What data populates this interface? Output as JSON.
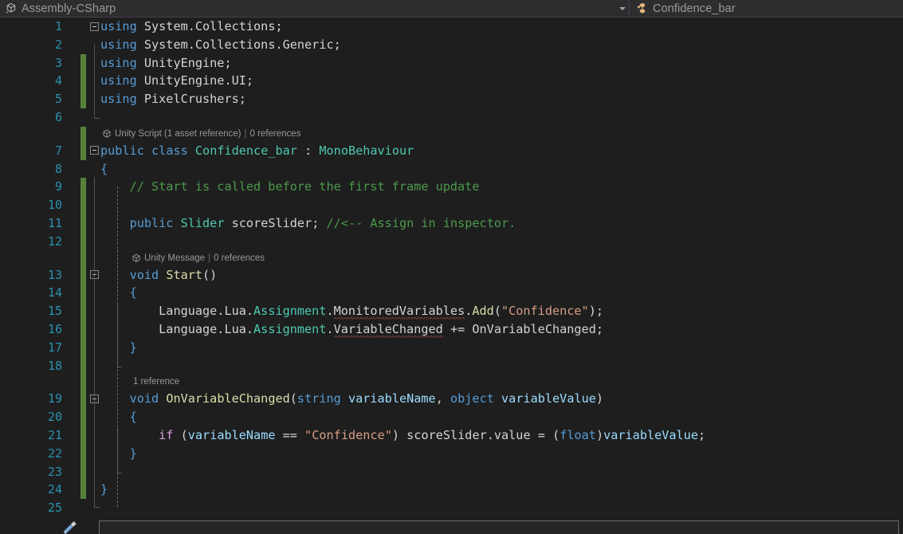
{
  "window": {
    "title": "Assembly-CSharp - Visual Studio code editor"
  },
  "navbar": {
    "project_selector": {
      "icon": "assembly-cube-icon",
      "label": "Assembly-CSharp",
      "dropdown_icon": "chevron-down-icon"
    },
    "member_selector": {
      "icon": "class-icon",
      "label": "Confidence_bar"
    }
  },
  "editor": {
    "language": "C#",
    "file_symbol": "Confidence_bar",
    "gutter_icon": "screwdriver-quick-actions-icon",
    "colors": {
      "background": "#1e1e1e",
      "navbar_background": "#2d2d30",
      "line_number": "#2b91af",
      "change_bar_green": "#57803a",
      "keyword_blue": "#569cd6",
      "type_teal": "#4ec9b0",
      "string_orange": "#d69d85",
      "comment_green": "#4c9a4c",
      "method_yellow": "#dcdcaa",
      "parameter_lightblue": "#9cdcfe",
      "control_purple": "#d8a0df",
      "error_squiggle_red": "#d95b5b",
      "codelens_gray": "#999999",
      "default_text": "#d4d4d4"
    },
    "codelens": [
      {
        "id": "class-lens",
        "icon": "unity-cube-icon",
        "primary": "Unity Script (1 asset reference)",
        "separator": "|",
        "secondary": "0 references"
      },
      {
        "id": "start-lens",
        "icon": "unity-cube-icon",
        "primary": "Unity Message",
        "separator": "|",
        "secondary": "0 references"
      },
      {
        "id": "onvar-lens",
        "icon": "",
        "primary": "1 reference",
        "separator": "",
        "secondary": ""
      }
    ],
    "lines": [
      {
        "n": "1",
        "text": "using System.Collections;"
      },
      {
        "n": "2",
        "text": "using System.Collections.Generic;"
      },
      {
        "n": "3",
        "text": "using UnityEngine;"
      },
      {
        "n": "4",
        "text": "using UnityEngine.UI;"
      },
      {
        "n": "5",
        "text": "using PixelCrushers;"
      },
      {
        "n": "6",
        "text": ""
      },
      {
        "n": "7",
        "text": "public class Confidence_bar : MonoBehaviour"
      },
      {
        "n": "8",
        "text": "{"
      },
      {
        "n": "9",
        "text": "    // Start is called before the first frame update"
      },
      {
        "n": "10",
        "text": ""
      },
      {
        "n": "11",
        "text": "    public Slider scoreSlider; //<-- Assign in inspector."
      },
      {
        "n": "12",
        "text": ""
      },
      {
        "n": "13",
        "text": "    void Start()"
      },
      {
        "n": "14",
        "text": "    {"
      },
      {
        "n": "15",
        "text": "        Language.Lua.Assignment.MonitoredVariables.Add(\"Confidence\");"
      },
      {
        "n": "16",
        "text": "        Language.Lua.Assignment.VariableChanged += OnVariableChanged;"
      },
      {
        "n": "17",
        "text": "    }"
      },
      {
        "n": "18",
        "text": ""
      },
      {
        "n": "19",
        "text": "    void OnVariableChanged(string variableName, object variableValue)"
      },
      {
        "n": "20",
        "text": "    {"
      },
      {
        "n": "21",
        "text": "        if (variableName == \"Confidence\") scoreSlider.value = (float)variableValue;"
      },
      {
        "n": "22",
        "text": "    }"
      },
      {
        "n": "23",
        "text": ""
      },
      {
        "n": "24",
        "text": "}"
      },
      {
        "n": "25",
        "text": ""
      }
    ],
    "errors": [
      {
        "line": "15",
        "token": "MonitoredVariables"
      },
      {
        "line": "16",
        "token": "VariableChanged"
      }
    ]
  }
}
